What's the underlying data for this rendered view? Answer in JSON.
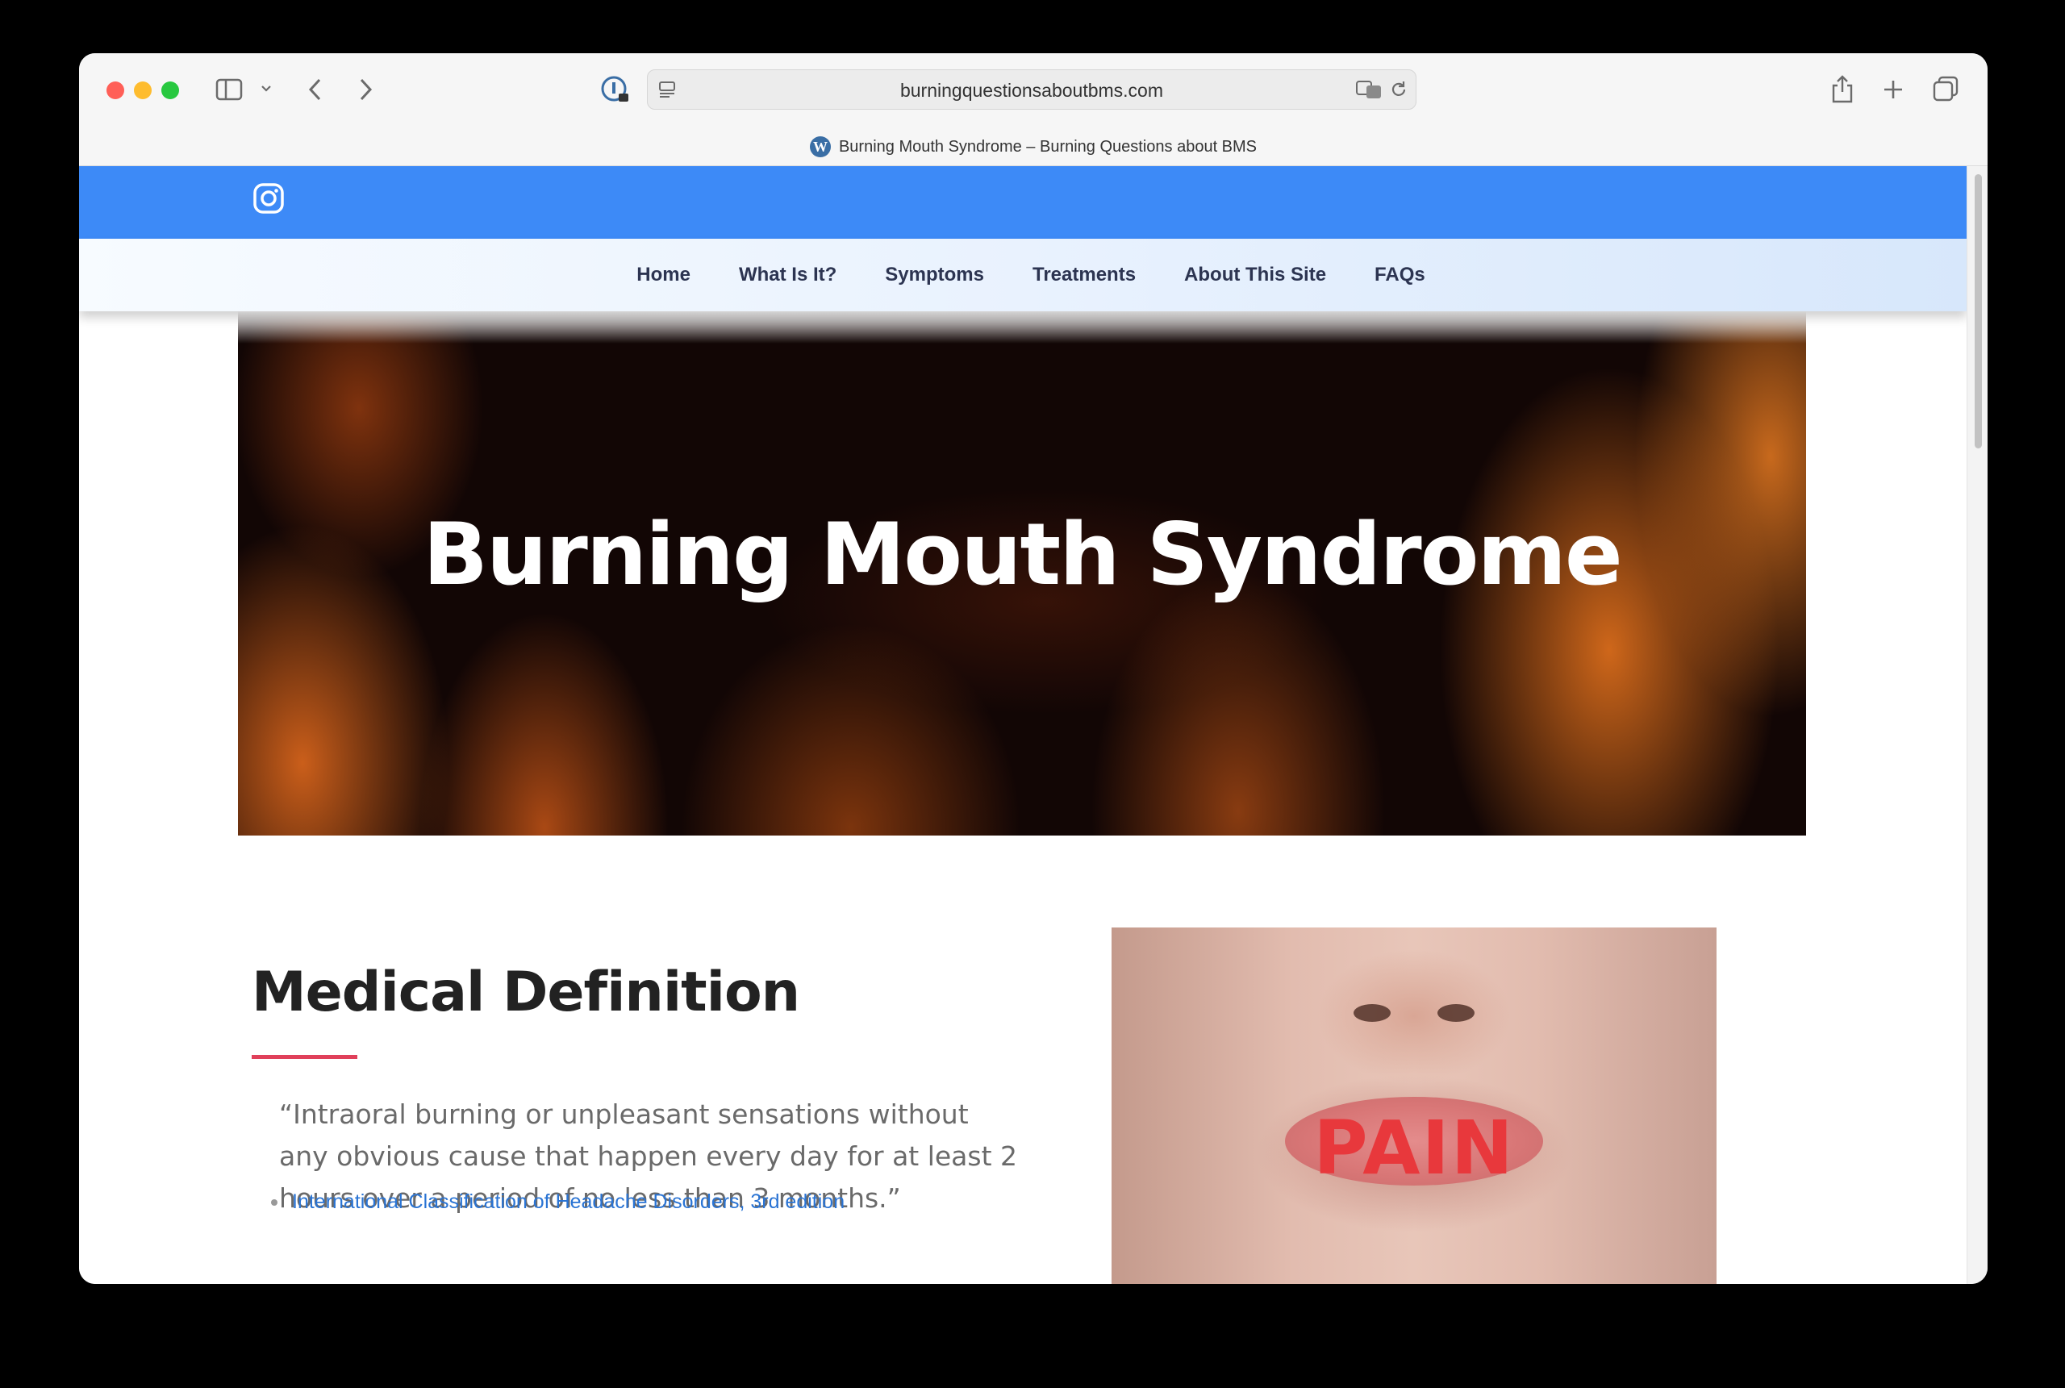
{
  "browser": {
    "url": "burningquestionsaboutbms.com",
    "tab_title": "Burning Mouth Syndrome – Burning Questions about BMS",
    "tab_favicon": "W"
  },
  "site": {
    "social_icon": "instagram-icon",
    "nav": [
      "Home",
      "What Is It?",
      "Symptoms",
      "Treatments",
      "About This Site",
      "FAQs"
    ],
    "hero_title": "Burning Mouth Syndrome",
    "section_heading": "Medical Definition",
    "quote": "“Intraoral burning or unpleasant sensations without any obvious cause that happen every day for at least 2 hours over a period of no less than 3 months.”",
    "reference_link": "International Classification of Headache Disorders, 3rd edition",
    "image_text": "PAIN"
  },
  "colors": {
    "topbar": "#3d8af7",
    "accent_underline": "#e0405a",
    "link": "#2a74d4",
    "pain_text": "#e8383c"
  }
}
